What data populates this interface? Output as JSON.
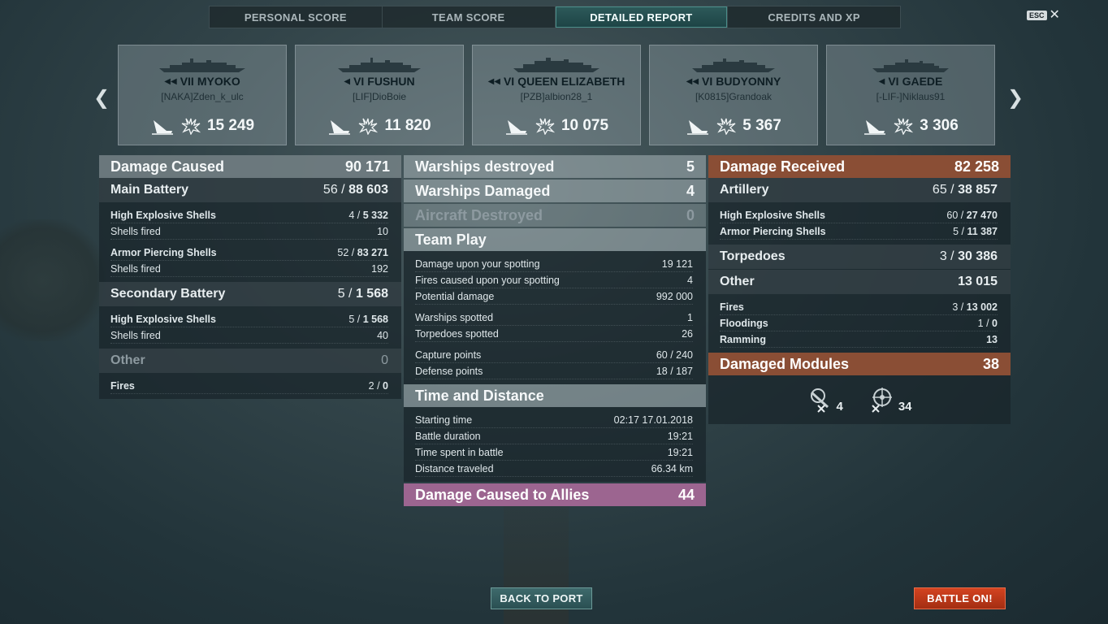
{
  "tabs": [
    "PERSONAL SCORE",
    "TEAM SCORE",
    "DETAILED REPORT",
    "CREDITS AND XP"
  ],
  "esc_label": "ESC",
  "cards": [
    {
      "tier": "VII",
      "name": "MYOKO",
      "player": "[NAKA]Zden_k_ulc",
      "damage": "15 249"
    },
    {
      "tier": "VI",
      "name": "FUSHUN",
      "player": "[LIF]DioBoie",
      "damage": "11 820"
    },
    {
      "tier": "VI",
      "name": "QUEEN ELIZABETH",
      "player": "[PZB]albion28_1",
      "damage": "10 075"
    },
    {
      "tier": "VI",
      "name": "BUDYONNY",
      "player": "[K0815]Grandoak",
      "damage": "5 367"
    },
    {
      "tier": "VI",
      "name": "GAEDE",
      "player": "[-LIF-]Niklaus91",
      "damage": "3 306"
    }
  ],
  "left": {
    "damage_caused": {
      "label": "Damage Caused",
      "value": "90 171"
    },
    "main_battery": {
      "label": "Main Battery",
      "hits": "56 /",
      "value": "88 603"
    },
    "he_shells": {
      "label": "High Explosive Shells",
      "hits": "4 /",
      "value": "5 332"
    },
    "he_fired": {
      "label": "Shells fired",
      "value": "10"
    },
    "ap_shells": {
      "label": "Armor Piercing Shells",
      "hits": "52 /",
      "value": "83 271"
    },
    "ap_fired": {
      "label": "Shells fired",
      "value": "192"
    },
    "secondary": {
      "label": "Secondary Battery",
      "hits": "5 /",
      "value": "1 568"
    },
    "sec_he": {
      "label": "High Explosive Shells",
      "hits": "5 /",
      "value": "1 568"
    },
    "sec_fired": {
      "label": "Shells fired",
      "value": "40"
    },
    "other": {
      "label": "Other",
      "value": "0"
    },
    "fires": {
      "label": "Fires",
      "hits": "2 /",
      "value": "0"
    }
  },
  "middle": {
    "destroyed": {
      "label": "Warships destroyed",
      "value": "5"
    },
    "damaged": {
      "label": "Warships Damaged",
      "value": "4"
    },
    "aircraft": {
      "label": "Aircraft Destroyed",
      "value": "0"
    },
    "team_play": "Team Play",
    "spotting_dmg": {
      "label": "Damage upon your spotting",
      "value": "19 121"
    },
    "spotting_fires": {
      "label": "Fires caused upon your spotting",
      "value": "4"
    },
    "potential": {
      "label": "Potential damage",
      "value": "992 000"
    },
    "spotted": {
      "label": "Warships spotted",
      "value": "1"
    },
    "torps_spotted": {
      "label": "Torpedoes spotted",
      "value": "26"
    },
    "capture": {
      "label": "Capture points",
      "value": "60 / 240"
    },
    "defense": {
      "label": "Defense points",
      "value": "18 / 187"
    },
    "time_distance": "Time and Distance",
    "start": {
      "label": "Starting time",
      "value": "02:17  17.01.2018"
    },
    "duration": {
      "label": "Battle duration",
      "value": "19:21"
    },
    "time_spent": {
      "label": "Time spent in battle",
      "value": "19:21"
    },
    "distance": {
      "label": "Distance traveled",
      "value": "66.34 km"
    },
    "allies": {
      "label": "Damage Caused to Allies",
      "value": "44"
    }
  },
  "right": {
    "received": {
      "label": "Damage Received",
      "value": "82 258"
    },
    "artillery": {
      "label": "Artillery",
      "hits": "65 /",
      "value": "38 857"
    },
    "he": {
      "label": "High Explosive Shells",
      "hits": "60 /",
      "value": "27 470"
    },
    "ap": {
      "label": "Armor Piercing Shells",
      "hits": "5 /",
      "value": "11 387"
    },
    "torpedoes": {
      "label": "Torpedoes",
      "hits": "3 /",
      "value": "30 386"
    },
    "other": {
      "label": "Other",
      "value": "13 015"
    },
    "fires": {
      "label": "Fires",
      "hits": "3 /",
      "value": "13 002"
    },
    "floodings": {
      "label": "Floodings",
      "hits": "1 /",
      "value": "0"
    },
    "ramming": {
      "label": "Ramming",
      "value": "13"
    },
    "modules": {
      "label": "Damaged Modules",
      "value": "38"
    },
    "mod_guns": "4",
    "mod_steering": "34"
  },
  "buttons": {
    "back": "BACK TO PORT",
    "battle": "BATTLE ON!"
  }
}
